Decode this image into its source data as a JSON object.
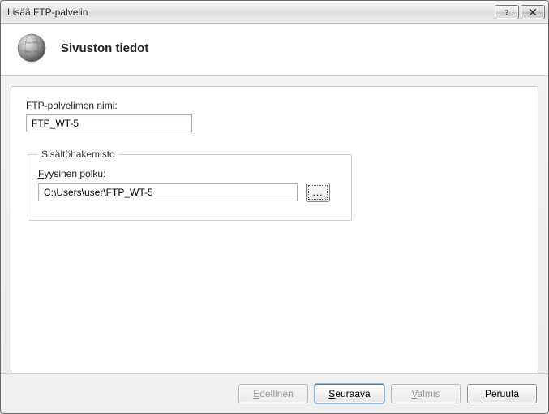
{
  "window": {
    "title": "Lisää FTP-palvelin"
  },
  "header": {
    "heading": "Sivuston tiedot"
  },
  "form": {
    "site_name": {
      "label_pre": "F",
      "label_rest": "TP-palvelimen nimi:",
      "value": "FTP_WT-5"
    },
    "content_dir": {
      "legend": "Sisältöhakemisto",
      "path_label_pre": "F",
      "path_label_rest": "yysinen polku:",
      "path_value": "C:\\Users\\user\\FTP_WT-5",
      "browse_label": "..."
    }
  },
  "footer": {
    "previous_pre": "E",
    "previous_rest": "dellinen",
    "next_pre": "S",
    "next_rest": "euraava",
    "finish_pre": "V",
    "finish_rest": "almis",
    "cancel": "Peruuta"
  }
}
